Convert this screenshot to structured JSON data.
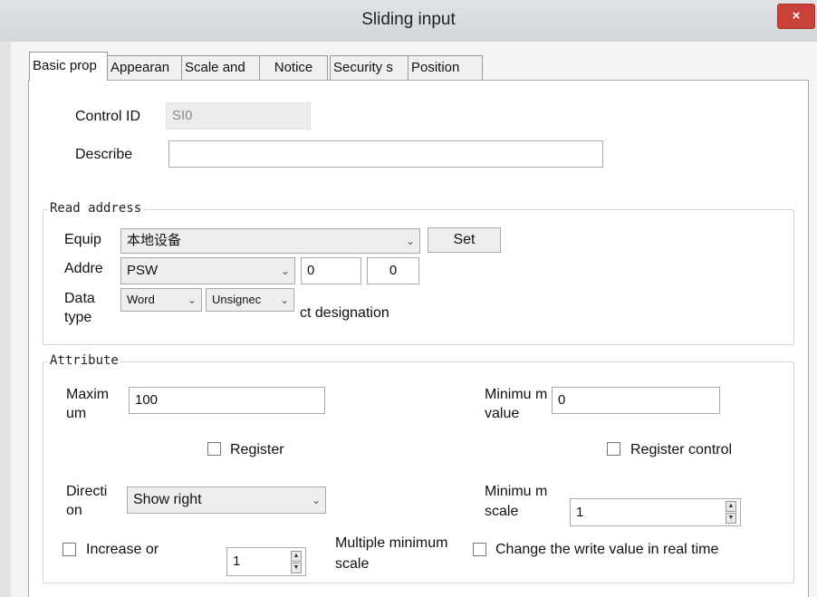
{
  "window": {
    "title": "Sliding input",
    "close_glyph": "×"
  },
  "tabs": [
    {
      "label": "Basic prop"
    },
    {
      "label": "Appearan"
    },
    {
      "label": "Scale and"
    },
    {
      "label": "Notice"
    },
    {
      "label": "Security s"
    },
    {
      "label": "Position"
    }
  ],
  "basic": {
    "control_id_label": "Control ID",
    "control_id_value": "SI0",
    "describe_label": "Describe",
    "describe_value": ""
  },
  "read_address": {
    "title": "Read address",
    "equip_label": "Equip",
    "equip_value": "本地设备",
    "set_label": "Set",
    "addr_label": "Addre",
    "addr_type": "PSW",
    "addr_value1": "0",
    "addr_value2": "0",
    "data_type_label": "Data type",
    "data_type_value": "Word",
    "sign_value": "Unsignec",
    "ct_designation": "ct designation"
  },
  "attribute": {
    "title": "Attribute",
    "maximum_label": "Maxim um",
    "maximum_value": "100",
    "minimum_label": "Minimu m value",
    "minimum_value": "0",
    "register_label": "Register",
    "register_control_label": "Register control",
    "direction_label": "Directi on",
    "direction_value": "Show right",
    "min_scale_label": "Minimu m scale",
    "min_scale_value": "1",
    "increase_label": "Increase or",
    "increase_value": "1",
    "multiple_label": "Multiple minimum scale",
    "realtime_label": "Change the write value in real time"
  },
  "icons": {
    "dropdown": "chevron-down-icon",
    "spin": "spin-arrows-icon",
    "close": "close-icon"
  }
}
